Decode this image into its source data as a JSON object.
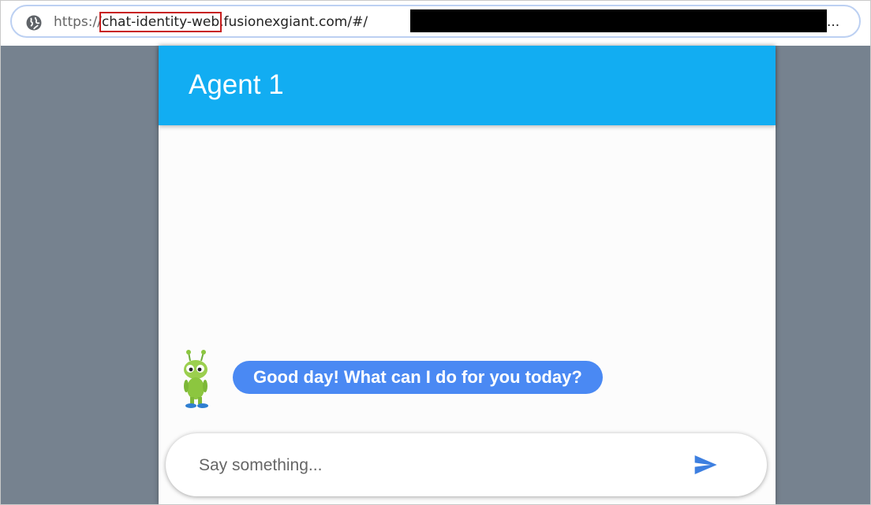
{
  "browser": {
    "url_scheme": "https://",
    "url_subdomain": "chat-identity-web",
    "url_host_rest": ".fusionexgiant.com/#/",
    "url_truncation": "..."
  },
  "chat": {
    "title": "Agent 1",
    "header_color": "#12adf2",
    "messages": [
      {
        "from": "bot",
        "text": "Good day! What can I do for you today?"
      }
    ],
    "bubble_color": "#4a89f3",
    "input": {
      "value": "",
      "placeholder": "Say something..."
    },
    "send_icon": "send-icon"
  },
  "colors": {
    "page_background": "#76828f",
    "highlight_box": "#c81e1e"
  }
}
